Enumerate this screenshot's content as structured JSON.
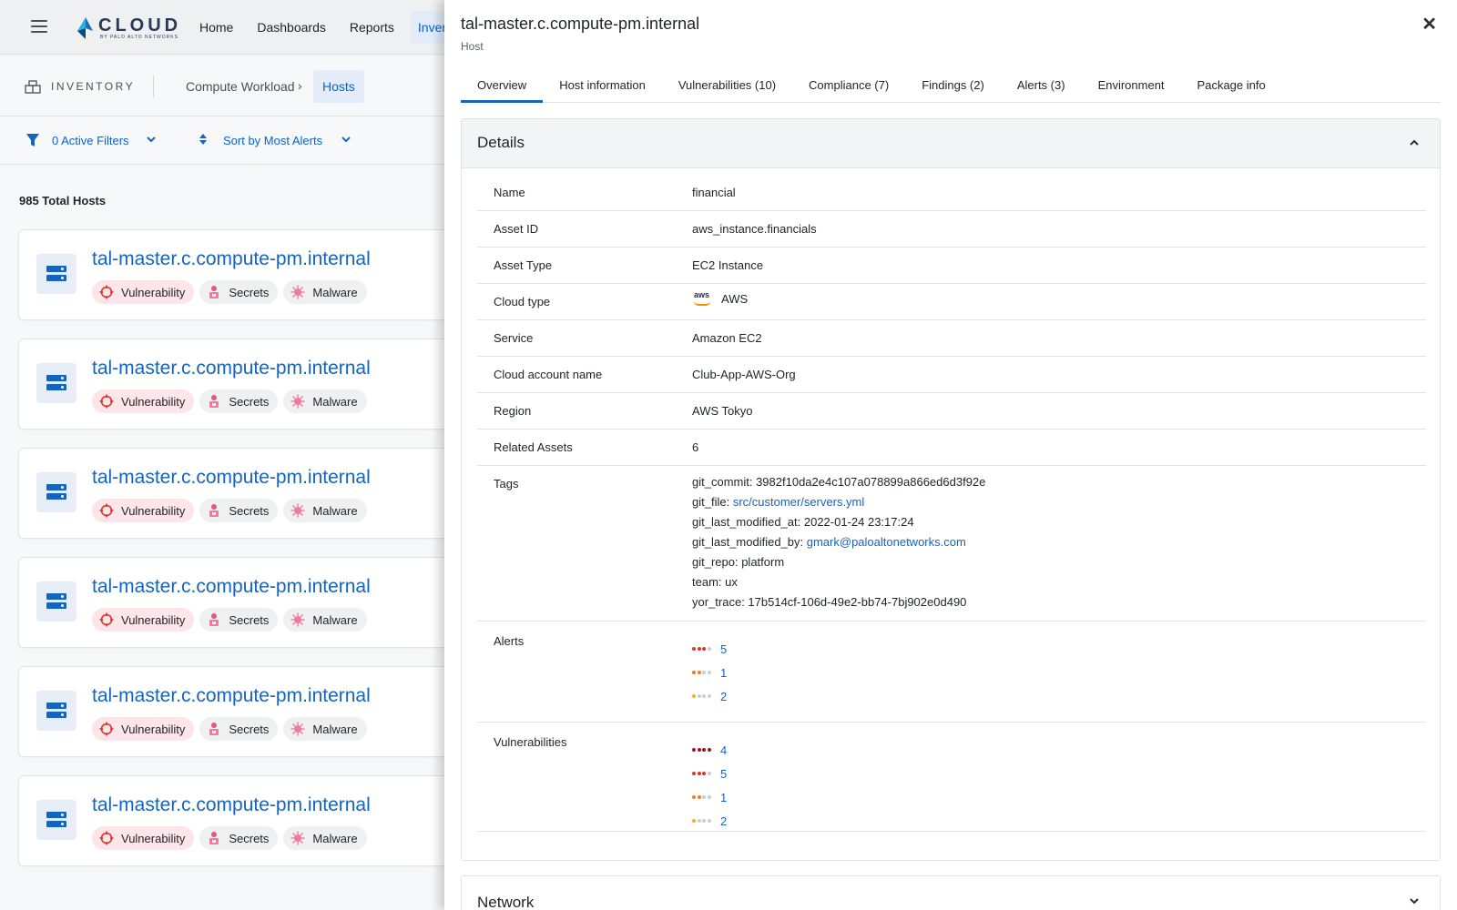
{
  "nav": {
    "brand": "CLOUD",
    "brand_sub": "BY PALO ALTO NETWORKS",
    "links": [
      "Home",
      "Dashboards",
      "Reports",
      "Inventory"
    ]
  },
  "subheader": {
    "section": "INVENTORY",
    "breadcrumb": [
      "Compute Workload",
      "Hosts"
    ]
  },
  "filters": {
    "active": "0 Active Filters",
    "sort": "Sort by Most Alerts"
  },
  "list": {
    "total": "985 Total Hosts",
    "hosts": [
      {
        "name": "tal-master.c.compute-pm.internal",
        "chips": [
          "Vulnerability",
          "Secrets",
          "Malware"
        ]
      },
      {
        "name": "tal-master.c.compute-pm.internal",
        "chips": [
          "Vulnerability",
          "Secrets",
          "Malware"
        ]
      },
      {
        "name": "tal-master.c.compute-pm.internal",
        "chips": [
          "Vulnerability",
          "Secrets",
          "Malware"
        ]
      },
      {
        "name": "tal-master.c.compute-pm.internal",
        "chips": [
          "Vulnerability",
          "Secrets",
          "Malware"
        ]
      },
      {
        "name": "tal-master.c.compute-pm.internal",
        "chips": [
          "Vulnerability",
          "Secrets",
          "Malware"
        ]
      },
      {
        "name": "tal-master.c.compute-pm.internal",
        "chips": [
          "Vulnerability",
          "Secrets",
          "Malware"
        ]
      }
    ]
  },
  "drawer": {
    "title": "tal-master.c.compute-pm.internal",
    "subtitle": "Host",
    "tabs": [
      "Overview",
      "Host information",
      "Vulnerabilities (10)",
      "Compliance (7)",
      "Findings (2)",
      "Alerts (3)",
      "Environment",
      "Package info"
    ],
    "details_title": "Details",
    "network_title": "Network",
    "details": {
      "name": {
        "label": "Name",
        "value": "financial"
      },
      "asset_id": {
        "label": "Asset ID",
        "value": "aws_instance.financials"
      },
      "asset_type": {
        "label": "Asset Type",
        "value": "EC2 Instance"
      },
      "cloud_type": {
        "label": "Cloud type",
        "value": "AWS",
        "logo_text": "aws"
      },
      "service": {
        "label": "Service",
        "value": "Amazon EC2"
      },
      "account": {
        "label": "Cloud account name",
        "value": "Club-App-AWS-Org"
      },
      "region": {
        "label": "Region",
        "value": "AWS Tokyo"
      },
      "related": {
        "label": "Related Assets",
        "value": "6"
      },
      "tags": {
        "label": "Tags",
        "git_commit": "git_commit: 3982f10da2e4c107a078899a866ed6d3f92e",
        "git_file_key": "git_file: ",
        "git_file_val": "src/customer/servers.yml",
        "git_last_modified_at": "git_last_modified_at: 2022-01-24 23:17:24",
        "git_last_modified_by_key": "git_last_modified_by: ",
        "git_last_modified_by_val": "gmark@paloaltonetworks.com",
        "git_repo": "git_repo: platform",
        "team": "team: ux",
        "yor_trace": "yor_trace: 17b514cf-106d-49e2-bb74-7bj902e0d490"
      },
      "alerts": {
        "label": "Alerts",
        "items": [
          {
            "severity": "high",
            "count": "5"
          },
          {
            "severity": "medium",
            "count": "1"
          },
          {
            "severity": "low",
            "count": "2"
          }
        ]
      },
      "vulnerabilities": {
        "label": "Vulnerabilities",
        "items": [
          {
            "severity": "critical",
            "count": "4"
          },
          {
            "severity": "high",
            "count": "5"
          },
          {
            "severity": "medium",
            "count": "1"
          },
          {
            "severity": "low",
            "count": "2"
          }
        ]
      }
    }
  },
  "colors": {
    "accent": "#1565c0",
    "critical": "#a0141e",
    "high": "#e0342b",
    "medium": "#f07c1c",
    "low": "#f2b21b",
    "inactive": "#c9ccd1"
  },
  "icons": [
    "menu-icon",
    "server-icon",
    "vulnerability-icon",
    "secrets-icon",
    "malware-icon",
    "filter-icon",
    "sort-icon",
    "chevron-down-icon",
    "chevron-up-icon",
    "close-icon",
    "inventory-icon",
    "aws-logo"
  ]
}
